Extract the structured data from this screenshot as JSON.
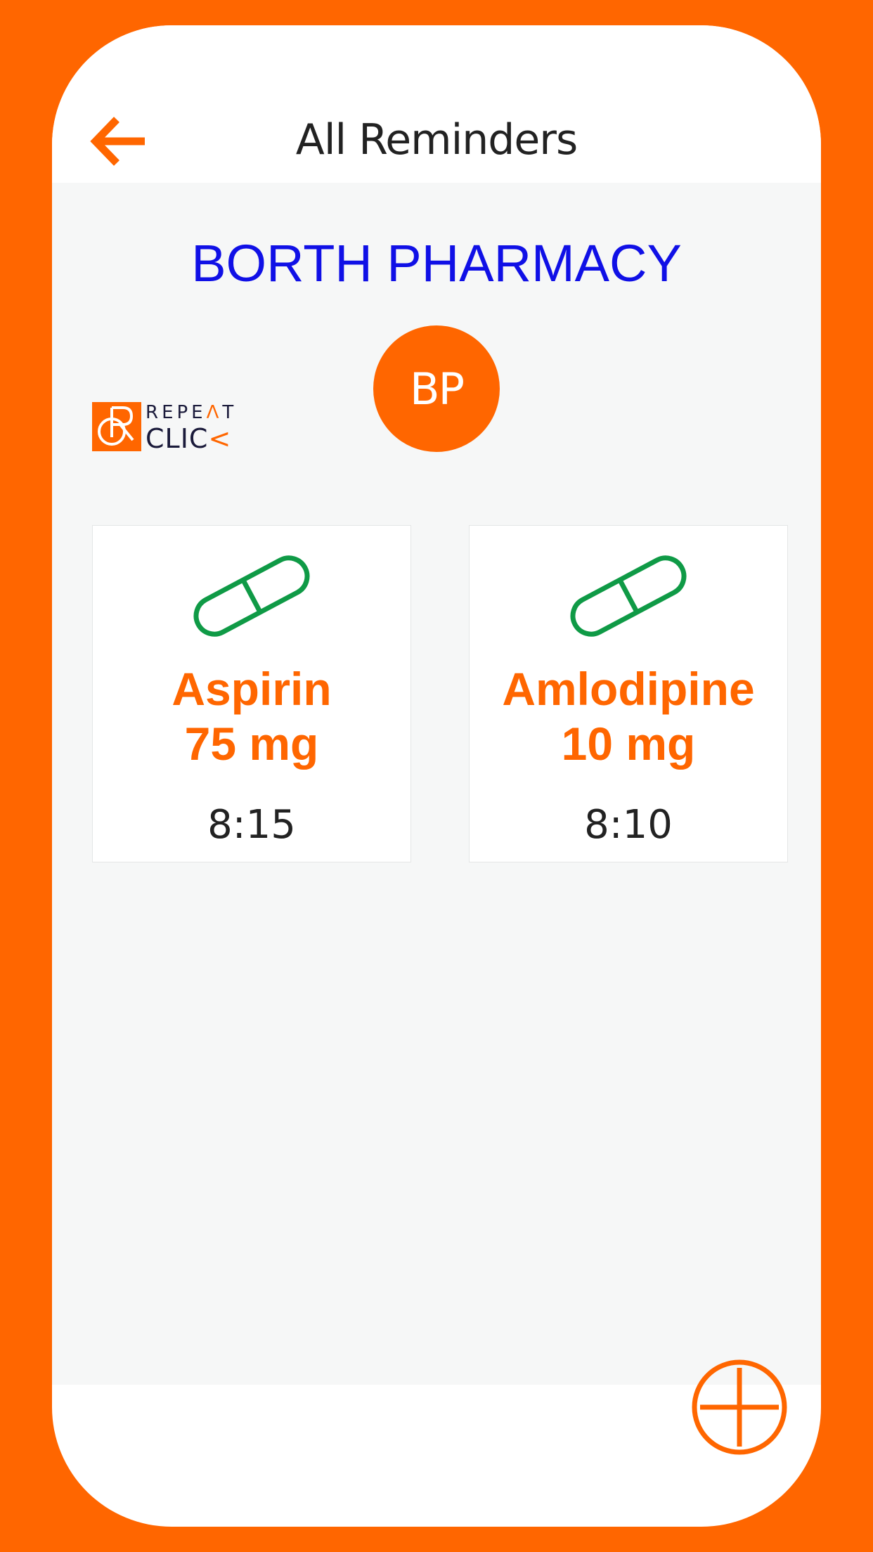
{
  "header": {
    "title": "All Reminders",
    "back_icon": "arrow-left-icon"
  },
  "pharmacy": {
    "name": "BORTH PHARMACY",
    "initials": "BP"
  },
  "logo": {
    "line1": "REPE",
    "line1_accent": "Λ",
    "line1_end": "T",
    "line2": "CLIC",
    "line2_accent": "<",
    "badge": "CR"
  },
  "reminders": [
    {
      "name": "Aspirin",
      "dose": "75 mg",
      "time": "8:15",
      "icon": "pill-icon"
    },
    {
      "name": "Amlodipine",
      "dose": "10 mg",
      "time": "8:10",
      "icon": "pill-icon"
    }
  ],
  "actions": {
    "add_icon": "plus-circle-icon"
  },
  "colors": {
    "accent": "#ff6600",
    "pharmacy_name": "#1010e6",
    "pill": "#0f9a46",
    "background": "#f6f7f7"
  }
}
